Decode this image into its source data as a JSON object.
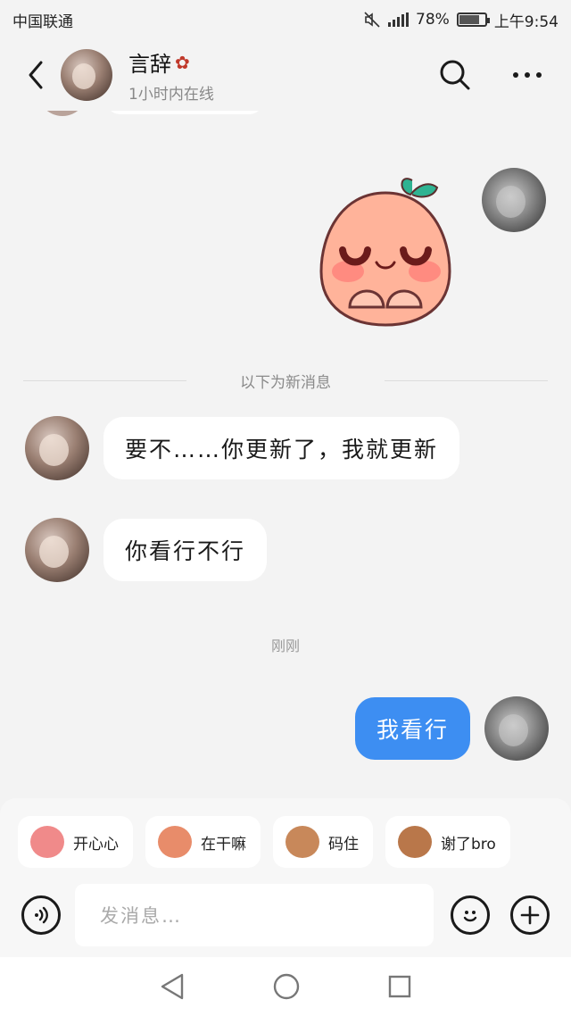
{
  "status": {
    "carrier": "中国联通",
    "battery": "78%",
    "time": "上午9:54"
  },
  "header": {
    "name": "言辞",
    "online_status": "1小时内在线"
  },
  "divider_label": "以下为新消息",
  "messages": [
    {
      "from": "them",
      "text": "要不……你更新了，我就更新"
    },
    {
      "from": "them",
      "text": "你看行不行"
    },
    {
      "from": "me",
      "text": "我看行"
    }
  ],
  "timestamp": "刚刚",
  "quick_replies": [
    {
      "label": "开心心",
      "color": "#f08a8a"
    },
    {
      "label": "在干嘛",
      "color": "#e88c6a"
    },
    {
      "label": "码住",
      "color": "#c8885a"
    },
    {
      "label": "谢了bro",
      "color": "#b9774a"
    }
  ],
  "input": {
    "placeholder": "发消息…"
  },
  "colors": {
    "accent": "#3d8ef2",
    "background": "#f3f3f3"
  }
}
